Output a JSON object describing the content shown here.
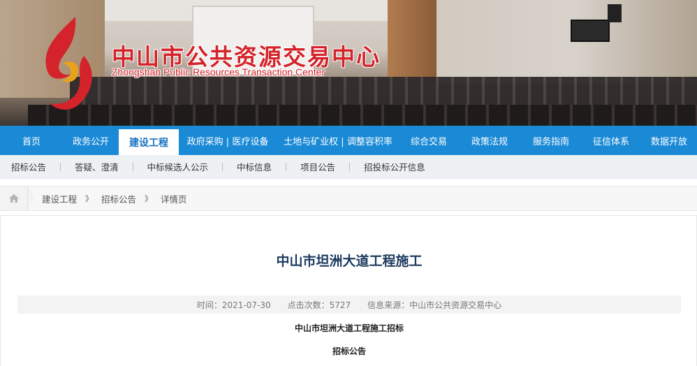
{
  "banner": {
    "title_cn": "中山市公共资源交易中心",
    "title_en": "Zhongshan Public Resources Transaction Center",
    "logo_icon": "flame-logo-icon",
    "brand_color": "#d4232a"
  },
  "mainnav": {
    "accent": "#1a8ad6",
    "items": [
      {
        "label": "首页"
      },
      {
        "label": "政务公开"
      },
      {
        "label": "建设工程",
        "active": true
      },
      {
        "label": "政府采购 | 医疗设备"
      },
      {
        "label": "土地与矿业权 | 调整容积率"
      },
      {
        "label": "综合交易"
      },
      {
        "label": "政策法规"
      },
      {
        "label": "服务指南"
      },
      {
        "label": "征信体系"
      },
      {
        "label": "数据开放"
      }
    ]
  },
  "subnav": {
    "items": [
      {
        "label": "招标公告"
      },
      {
        "label": "答疑、澄清"
      },
      {
        "label": "中标候选人公示"
      },
      {
        "label": "中标信息"
      },
      {
        "label": "项目公告"
      },
      {
        "label": "招投标公开信息"
      }
    ]
  },
  "breadcrumb": {
    "home_icon": "home-icon",
    "items": [
      {
        "label": "建设工程"
      },
      {
        "label": "招标公告"
      },
      {
        "label": "详情页"
      }
    ],
    "separator": "》"
  },
  "article": {
    "title": "中山市坦洲大道工程施工",
    "time": "时间：2021-07-30",
    "clicks": "点击次数：5727",
    "source": "信息来源：中山市公共资源交易中心",
    "heading1": "中山市坦洲大道工程施工招标",
    "heading2": "招标公告"
  }
}
